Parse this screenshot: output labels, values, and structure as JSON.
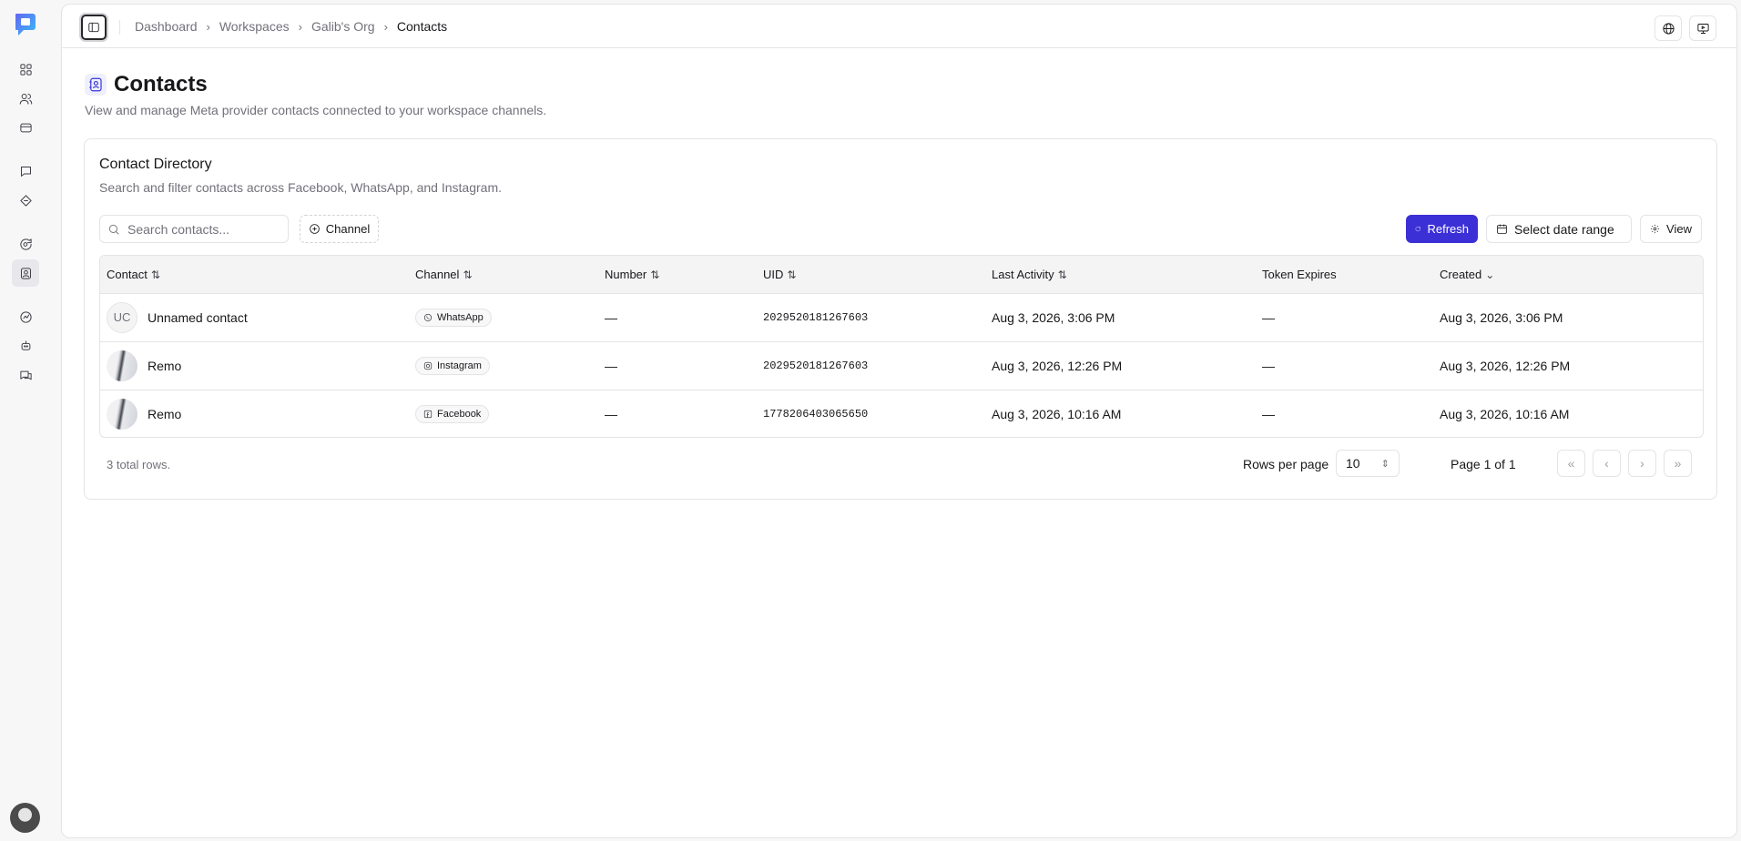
{
  "breadcrumb": [
    "Dashboard",
    "Workspaces",
    "Galib's Org",
    "Contacts"
  ],
  "page": {
    "title": "Contacts",
    "subtitle": "View and manage Meta provider contacts connected to your workspace channels."
  },
  "card": {
    "title": "Contact Directory",
    "subtitle": "Search and filter contacts across Facebook, WhatsApp, and Instagram."
  },
  "toolbar": {
    "search_placeholder": "Search contacts...",
    "channel_filter": "Channel",
    "refresh": "Refresh",
    "date_range": "Select date range",
    "view": "View"
  },
  "table": {
    "headers": [
      "Contact",
      "Channel",
      "Number",
      "UID",
      "Last Activity",
      "Token Expires",
      "Created"
    ],
    "rows": [
      {
        "initials": "UC",
        "name": "Unnamed contact",
        "channel": "WhatsApp",
        "channel_icon": "whatsapp-icon",
        "number": "—",
        "uid": "2029520181267603",
        "last_activity": "Aug 3, 2026, 3:06 PM",
        "token_expires": "—",
        "created": "Aug 3, 2026, 3:06 PM"
      },
      {
        "initials": "",
        "name": "Remo",
        "channel": "Instagram",
        "channel_icon": "instagram-icon",
        "number": "—",
        "uid": "2029520181267603",
        "last_activity": "Aug 3, 2026, 12:26 PM",
        "token_expires": "—",
        "created": "Aug 3, 2026, 12:26 PM"
      },
      {
        "initials": "",
        "name": "Remo",
        "channel": "Facebook",
        "channel_icon": "facebook-icon",
        "number": "—",
        "uid": "1778206403065650",
        "last_activity": "Aug 3, 2026, 10:16 AM",
        "token_expires": "—",
        "created": "Aug 3, 2026, 10:16 AM"
      }
    ]
  },
  "footer": {
    "total": "3 total rows.",
    "rows_per_page_label": "Rows per page",
    "rows_per_page": "10",
    "page_info": "Page 1 of 1"
  },
  "colors": {
    "accent": "#3b30d6",
    "border": "#e4e4e7",
    "muted_text": "#71717a"
  }
}
